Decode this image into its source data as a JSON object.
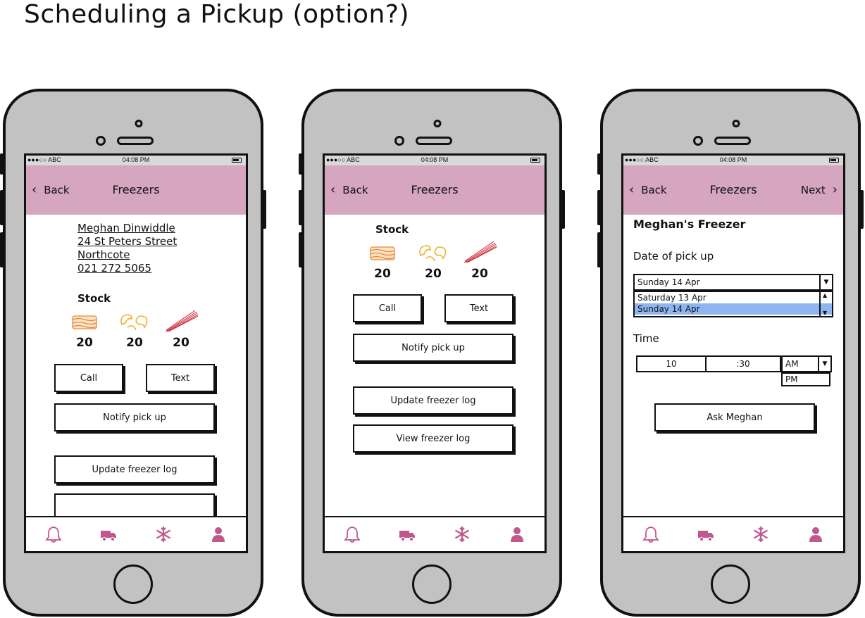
{
  "page": {
    "title": "Scheduling a Pickup (option?)"
  },
  "status_bar": {
    "carrier": "●●●○○ ABC",
    "time": "04:08 PM"
  },
  "nav": {
    "back": "Back",
    "title": "Freezers",
    "next": "Next"
  },
  "contact": {
    "name": "Meghan Dinwiddle",
    "street": "24 St Peters Street",
    "suburb": "Northcote",
    "phone": "021 272 5065"
  },
  "stock": {
    "label": "Stock",
    "items": [
      {
        "icon": "lasagne-icon",
        "count": "20"
      },
      {
        "icon": "macaroni-icon",
        "count": "20"
      },
      {
        "icon": "spaghetti-icon",
        "count": "20"
      }
    ]
  },
  "buttons": {
    "call": "Call",
    "text": "Text",
    "notify": "Notify pick up",
    "update_log": "Update freezer log",
    "view_log": "View freezer log",
    "ask": "Ask Meghan"
  },
  "schedule": {
    "heading": "Meghan's Freezer",
    "date_label": "Date of pick up",
    "date_value": "Sunday 14 Apr",
    "date_options": [
      "Saturday 13 Apr",
      "Sunday 14 Apr"
    ],
    "time_label": "Time",
    "hour": "10",
    "minute": ":30",
    "ampm": "AM",
    "ampm_options": [
      "PM"
    ]
  },
  "tabbar": [
    "bell-icon",
    "truck-icon",
    "snowflake-icon",
    "user-icon"
  ],
  "colors": {
    "nav_bg": "#d6a5bf",
    "tab_icon": "#c0578f",
    "food_orange": "#e8883a",
    "food_yellow": "#f0b030",
    "spaghetti_red": "#c82030",
    "selected": "#8fb5f0"
  }
}
